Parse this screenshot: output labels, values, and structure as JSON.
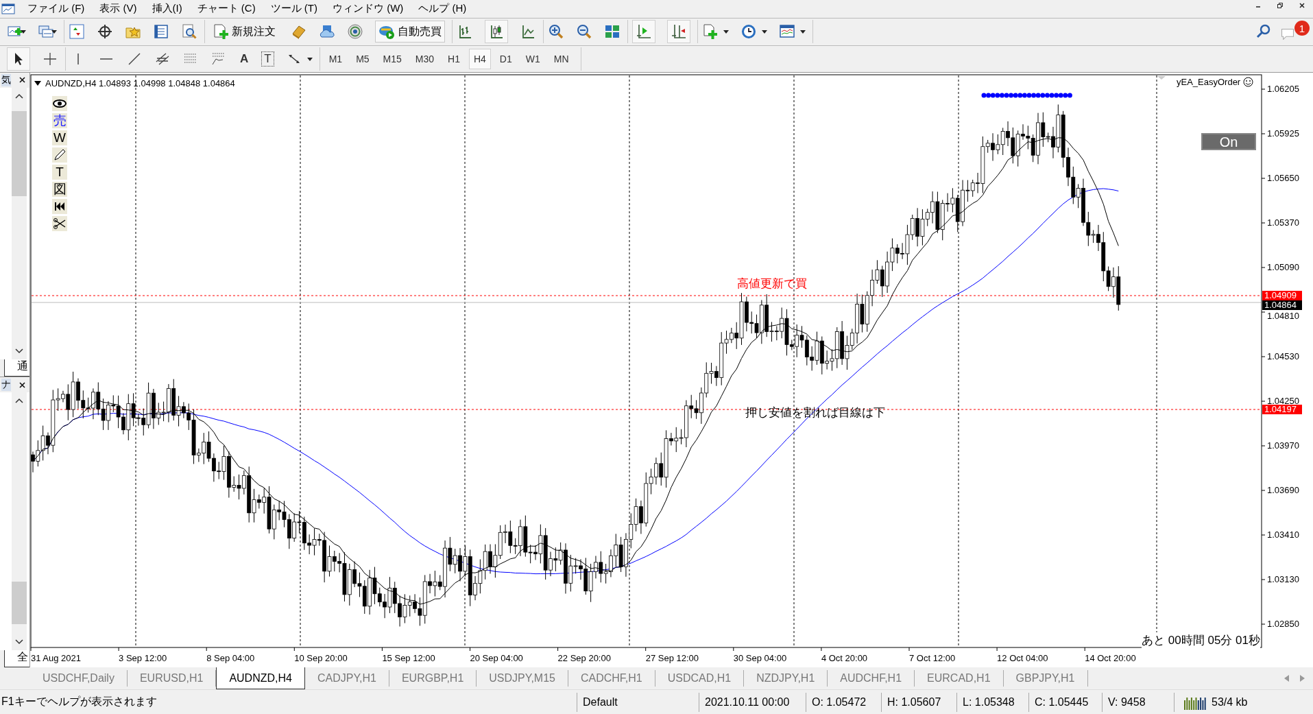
{
  "menu": [
    "ファイル (F)",
    "表示 (V)",
    "挿入(I)",
    "チャート (C)",
    "ツール (T)",
    "ウィンドウ (W)",
    "ヘルプ (H)"
  ],
  "toolbar": {
    "order_button": "新規注文",
    "autotrade_button": "自動売買",
    "notification_count": "1"
  },
  "drawing_tools": {
    "text_tool": "A",
    "label_tool": "T"
  },
  "timeframes": [
    {
      "label": "M1",
      "selected": false
    },
    {
      "label": "M5",
      "selected": false
    },
    {
      "label": "M15",
      "selected": false
    },
    {
      "label": "M30",
      "selected": false
    },
    {
      "label": "H1",
      "selected": false
    },
    {
      "label": "H4",
      "selected": true
    },
    {
      "label": "D1",
      "selected": false
    },
    {
      "label": "W1",
      "selected": false
    },
    {
      "label": "MN",
      "selected": false
    }
  ],
  "side_panels": [
    {
      "title": "気",
      "tab": "通"
    },
    {
      "title": "ナ",
      "tab": "全"
    }
  ],
  "chart": {
    "header": "AUDNZD,H4  1.04893 1.04998 1.04848 1.04864",
    "ea_name": "yEA_EasyOrder",
    "ea_button": "On",
    "tools": [
      {
        "kind": "eye"
      },
      {
        "kind": "char",
        "label": "売"
      },
      {
        "kind": "char",
        "label": "W"
      },
      {
        "kind": "pencil"
      },
      {
        "kind": "char",
        "label": "T"
      },
      {
        "kind": "char",
        "label": "図"
      },
      {
        "kind": "rewind"
      },
      {
        "kind": "scissors"
      }
    ],
    "price_labels": [
      "1.06205",
      "1.05925",
      "1.05650",
      "1.05370",
      "1.05090",
      "1.04810",
      "1.04530",
      "1.04250",
      "1.03970",
      "1.03690",
      "1.03410",
      "1.03130",
      "1.02850"
    ],
    "date_labels": [
      "31 Aug 2021",
      "3 Sep 12:00",
      "8 Sep 04:00",
      "10 Sep 20:00",
      "15 Sep 12:00",
      "20 Sep 04:00",
      "22 Sep 20:00",
      "27 Sep 12:00",
      "30 Sep 04:00",
      "4 Oct 20:00",
      "7 Oct 12:00",
      "12 Oct 04:00",
      "14 Oct 20:00"
    ],
    "lines": [
      {
        "kind": "level",
        "label": "1.04909"
      },
      {
        "kind": "bid",
        "label": "1.04864"
      },
      {
        "kind": "level",
        "label": "1.04197"
      }
    ],
    "notes": [
      {
        "text": "高値更新で買",
        "color": "#ff0000"
      },
      {
        "text": "押し安値を割れば目線は下",
        "color": "#000000"
      }
    ],
    "countdown": "あと 00時間  05分 01秒"
  },
  "tabs": [
    {
      "label": "USDCHF,Daily",
      "selected": false
    },
    {
      "label": "EURUSD,H1",
      "selected": false
    },
    {
      "label": "AUDNZD,H4",
      "selected": true
    },
    {
      "label": "CADJPY,H1",
      "selected": false
    },
    {
      "label": "EURGBP,H1",
      "selected": false
    },
    {
      "label": "USDJPY,M15",
      "selected": false
    },
    {
      "label": "CADCHF,H1",
      "selected": false
    },
    {
      "label": "USDCAD,H1",
      "selected": false
    },
    {
      "label": "NZDJPY,H1",
      "selected": false
    },
    {
      "label": "AUDCHF,H1",
      "selected": false
    },
    {
      "label": "EURCAD,H1",
      "selected": false
    },
    {
      "label": "GBPJPY,H1",
      "selected": false
    }
  ],
  "status_bar": {
    "help": "F1キーでヘルプが表示されます",
    "profile": "Default",
    "time": "2021.10.11 00:00",
    "open": "O: 1.05472",
    "high": "H: 1.05607",
    "low": "L: 1.05348",
    "close": "C: 1.05445",
    "volume": "V: 9458",
    "traffic": "53/4 kb"
  }
}
